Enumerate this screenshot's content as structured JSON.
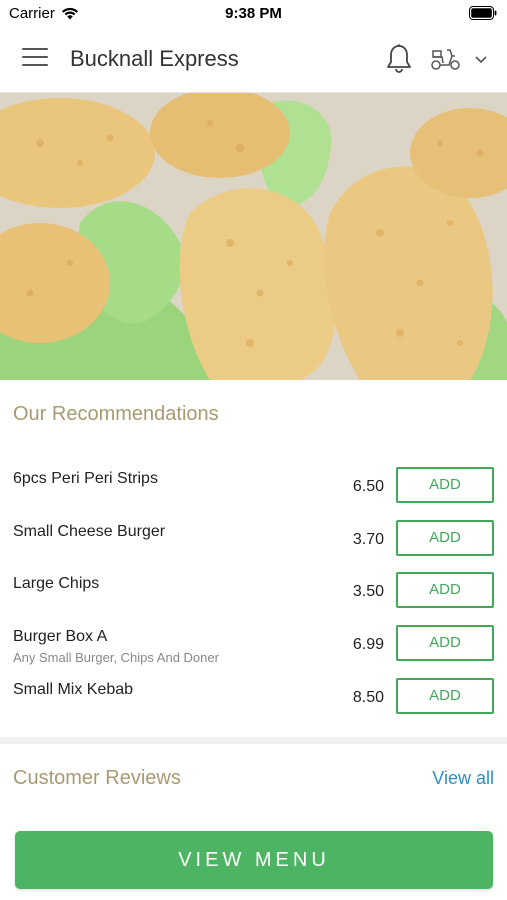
{
  "status_bar": {
    "carrier": "Carrier",
    "time": "9:38 PM"
  },
  "header": {
    "title": "Bucknall Express",
    "menu_icon": "hamburger-menu-icon",
    "notification_icon": "bell-icon",
    "delivery_icon": "scooter-icon",
    "dropdown_icon": "chevron-down-icon"
  },
  "hero": {
    "image": "crispy-chicken-strips-photo"
  },
  "recommendations": {
    "title": "Our Recommendations",
    "items": [
      {
        "name": "6pcs Peri Peri Strips",
        "description": "",
        "price": "6.50",
        "add_label": "ADD"
      },
      {
        "name": "Small Cheese Burger",
        "description": "",
        "price": "3.70",
        "add_label": "ADD"
      },
      {
        "name": "Large Chips",
        "description": "",
        "price": "3.50",
        "add_label": "ADD"
      },
      {
        "name": "Burger Box A",
        "description": "Any Small Burger, Chips And Doner",
        "price": "6.99",
        "add_label": "ADD"
      },
      {
        "name": "Small Mix Kebab",
        "description": "",
        "price": "8.50",
        "add_label": "ADD"
      }
    ]
  },
  "reviews": {
    "title": "Customer Reviews",
    "view_all_label": "View all"
  },
  "footer": {
    "view_menu_label": "VIEW MENU"
  },
  "colors": {
    "accent_green": "#4cb462",
    "section_title": "#a89a72",
    "link_blue": "#2d8fc1"
  }
}
